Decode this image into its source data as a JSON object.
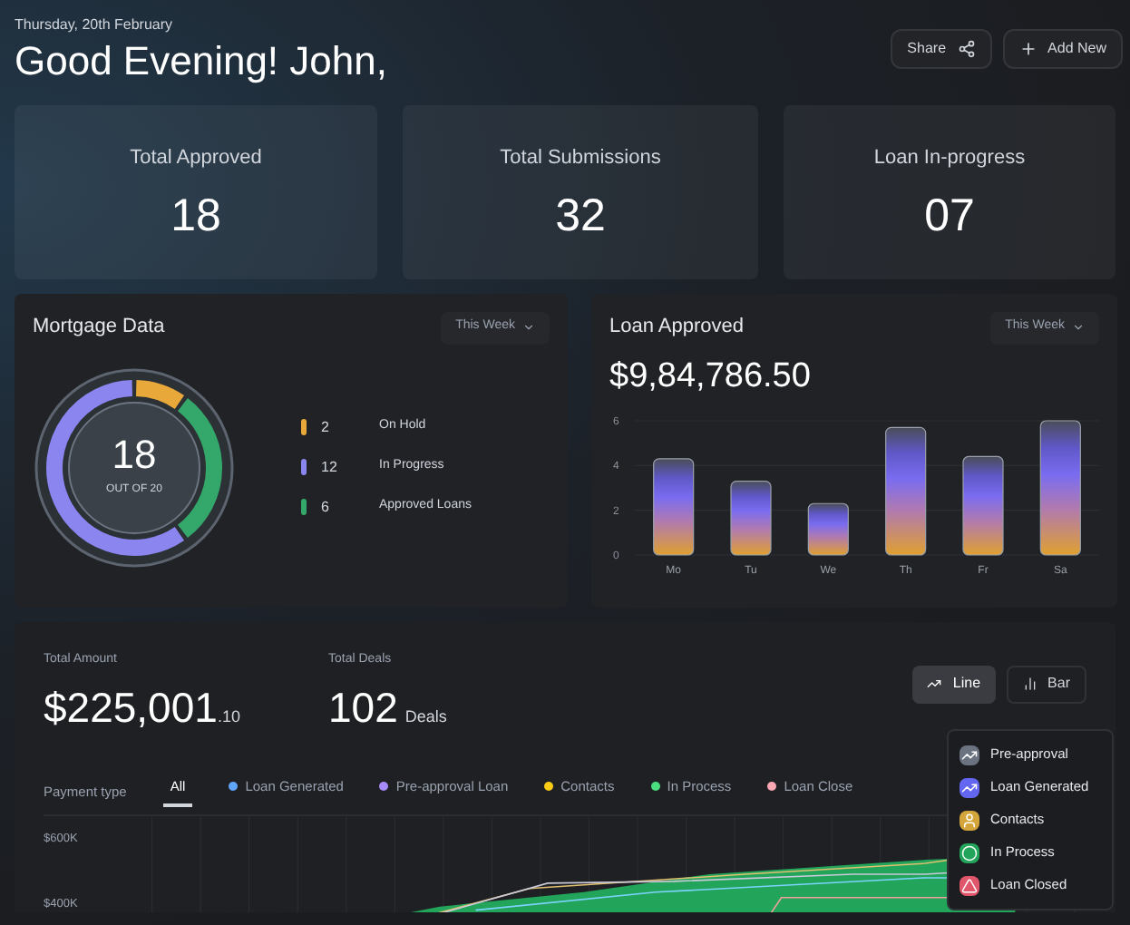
{
  "header": {
    "date": "Thursday, 20th February",
    "greeting": "Good Evening! John,",
    "buttons": [
      {
        "kind": "share",
        "label": "Share"
      },
      {
        "kind": "add",
        "label": "Add New"
      }
    ]
  },
  "stats": [
    {
      "label": "Total Approved",
      "value": "18"
    },
    {
      "label": "Total Submissions",
      "value": "32"
    },
    {
      "label": "Loan In-progress",
      "value": "07"
    }
  ],
  "mortgage": {
    "title": "Mortgage Data",
    "period": "This Week",
    "center_value": "18",
    "center_caption": "OUT OF 20",
    "legend": [
      {
        "count": "2",
        "label": "On Hold",
        "color": "#e9a93a"
      },
      {
        "count": "12",
        "label": "In Progress",
        "color": "#8b85f0"
      },
      {
        "count": "6",
        "label": "Approved Loans",
        "color": "#34a86a"
      }
    ]
  },
  "loan_approved": {
    "title": "Loan Approved",
    "period": "This Week",
    "amount": "$9,84,786.50",
    "chart_data": {
      "type": "bar",
      "categories": [
        "Mo",
        "Tu",
        "We",
        "Th",
        "Fr",
        "Sa"
      ],
      "values": [
        4.3,
        3.3,
        2.3,
        5.7,
        4.4,
        6
      ],
      "ylim": [
        0,
        6
      ],
      "grid": true,
      "yticks": [
        0,
        2,
        4,
        6
      ]
    }
  },
  "summary": {
    "total_amount_label": "Total Amount",
    "total_amount": "$225,001",
    "total_amount_cents": ".10",
    "total_deals_label": "Total Deals",
    "total_deals": "102",
    "deals_unit": "Deals",
    "view_toggle": [
      {
        "kind": "line",
        "label": "Line",
        "selected": true
      },
      {
        "kind": "bar",
        "label": "Bar",
        "selected": false
      }
    ],
    "payment_type_label": "Payment type",
    "filters": [
      {
        "label": "All",
        "selected": true
      },
      {
        "label": "Loan Generated",
        "selected": false,
        "color": "#60a5fa"
      },
      {
        "label": "Pre-approval Loan",
        "selected": false,
        "color": "#a78bfa"
      },
      {
        "label": "Contacts",
        "selected": false,
        "color": "#facc15"
      },
      {
        "label": "In Process",
        "selected": false,
        "color": "#4ade80"
      },
      {
        "label": "Loan Close",
        "selected": false,
        "color": "#f9a8b4"
      }
    ],
    "y_axis_labels": [
      "$600K",
      "$400K"
    ],
    "menu": [
      {
        "label": "Pre-approval",
        "color": "#6b7280"
      },
      {
        "label": "Loan Generated",
        "color": "#6366f1"
      },
      {
        "label": "Contacts",
        "color": "#d4a53a"
      },
      {
        "label": "In Process",
        "color": "#22a55a"
      },
      {
        "label": "Loan Closed",
        "color": "#e0566a"
      }
    ]
  }
}
